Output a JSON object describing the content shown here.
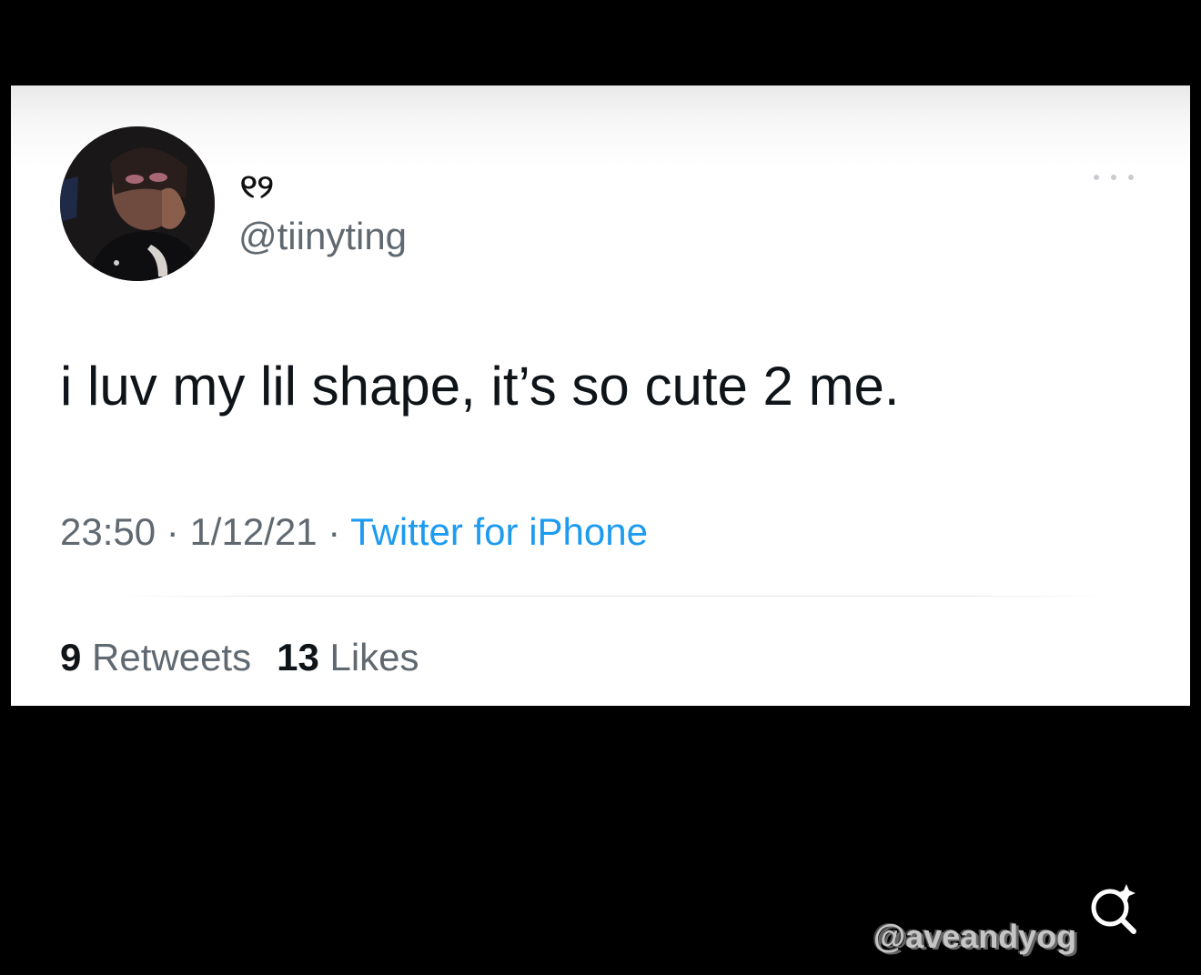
{
  "tweet": {
    "display_name": "୧୨",
    "handle": "@tiinyting",
    "text": "i luv my lil shape, it’s so cute 2 me.",
    "time": "23:50",
    "separator": " · ",
    "date": "1/12/21",
    "source": "Twitter for iPhone",
    "retweets_count": "9",
    "retweets_label": " Retweets",
    "likes_count": "13",
    "likes_label": " Likes"
  },
  "overlay": {
    "watermark_text": "@aveandyog"
  },
  "icons": {
    "more": "more-horizontal-icon",
    "search": "search-sparkle-icon",
    "avatar": "profile-photo"
  },
  "colors": {
    "background": "#000000",
    "card": "#ffffff",
    "text": "#0f1419",
    "secondary": "#606870",
    "link": "#1d9bf0"
  }
}
